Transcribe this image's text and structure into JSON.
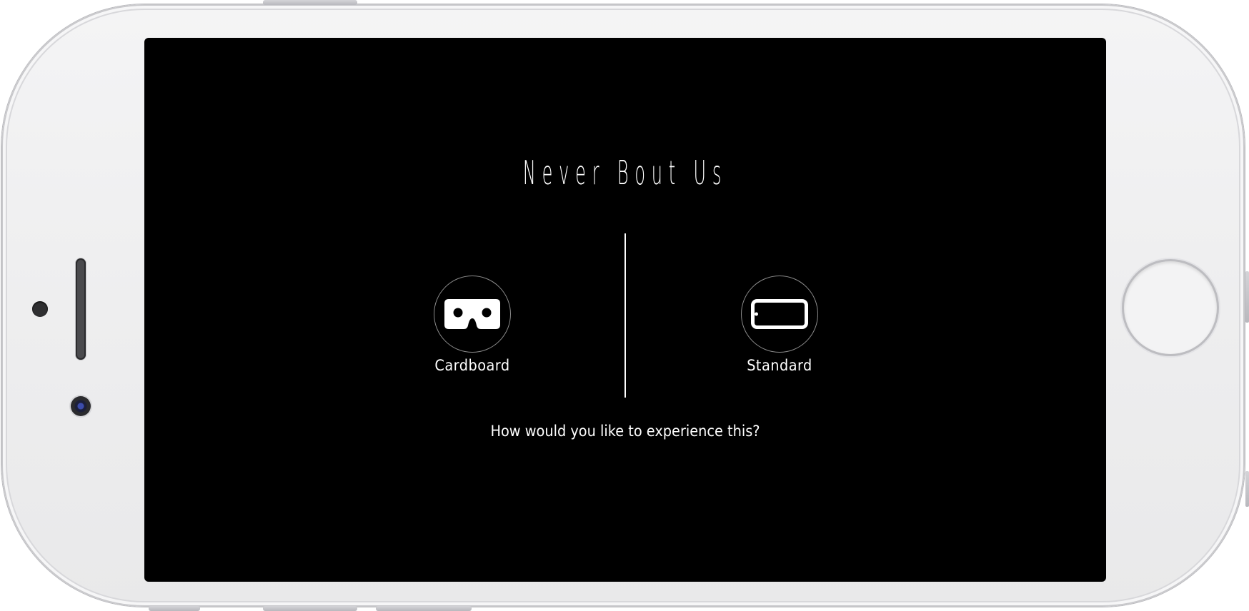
{
  "screen": {
    "title": "Never Bout Us",
    "prompt": "How would you like to experience this?",
    "options": [
      {
        "label": "Cardboard",
        "icon": "cardboard-viewer-icon"
      },
      {
        "label": "Standard",
        "icon": "phone-landscape-icon"
      }
    ]
  },
  "colors": {
    "screen_background": "#000000",
    "text": "#ffffff",
    "circle_border": "#8b8b8b",
    "device_body": "#eeeeef"
  }
}
